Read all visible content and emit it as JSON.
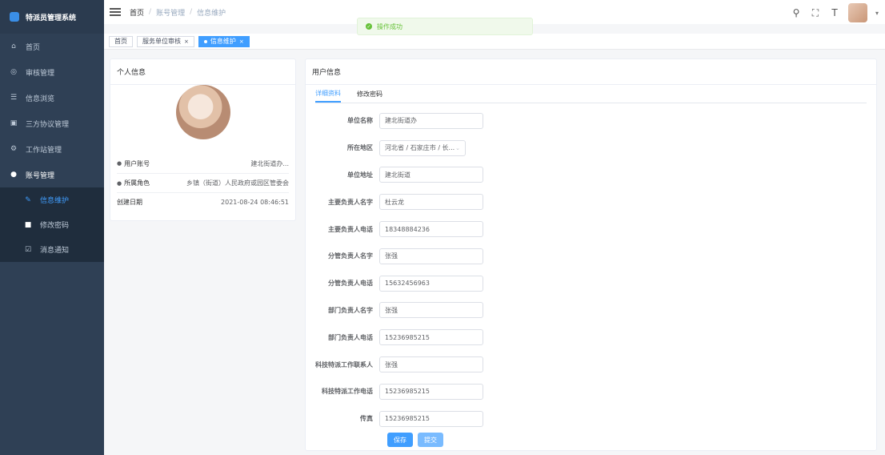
{
  "app": {
    "title": "特派员管理系统"
  },
  "sidebar": {
    "items": [
      {
        "label": "首页",
        "icon": "home-icon"
      },
      {
        "label": "审核管理",
        "icon": "audit-icon"
      },
      {
        "label": "信息浏览",
        "icon": "browse-icon"
      },
      {
        "label": "三方协议管理",
        "icon": "agreement-icon"
      },
      {
        "label": "工作站管理",
        "icon": "station-icon"
      },
      {
        "label": "账号管理",
        "icon": "user-icon"
      }
    ],
    "subitems": [
      {
        "label": "信息维护",
        "icon": "edit-icon",
        "active": true
      },
      {
        "label": "修改密码",
        "icon": "lock-icon"
      },
      {
        "label": "消息通知",
        "icon": "message-icon"
      }
    ]
  },
  "breadcrumb": [
    "首页",
    "账号管理",
    "信息维护"
  ],
  "tags": [
    {
      "label": "首页"
    },
    {
      "label": "服务单位审核"
    },
    {
      "label": "信息维护",
      "active": true
    }
  ],
  "toast": {
    "text": "操作成功"
  },
  "profile": {
    "title": "个人信息",
    "rows": [
      {
        "label": "用户账号",
        "value": "建北街道办..."
      },
      {
        "label": "所属角色",
        "value": "乡镇（街道）人民政府或园区管委会"
      },
      {
        "label": "创建日期",
        "value": "2021-08-24 08:46:51"
      }
    ]
  },
  "userinfo": {
    "title": "用户信息",
    "tabs": [
      "详细资料",
      "修改密码"
    ],
    "fields": [
      {
        "label": "单位名称",
        "value": "建北街道办"
      },
      {
        "label": "所在地区",
        "value": "河北省 / 石家庄市 / 长...",
        "select": true
      },
      {
        "label": "单位地址",
        "value": "建北街道"
      },
      {
        "label": "主要负责人名字",
        "value": "杜云龙"
      },
      {
        "label": "主要负责人电话",
        "value": "18348884236"
      },
      {
        "label": "分管负责人名字",
        "value": "张强"
      },
      {
        "label": "分管负责人电话",
        "value": "15632456963"
      },
      {
        "label": "部门负责人名字",
        "value": "张强"
      },
      {
        "label": "部门负责人电话",
        "value": "15236985215"
      },
      {
        "label": "科技特派工作联系人",
        "value": "张强"
      },
      {
        "label": "科技特派工作电话",
        "value": "15236985215"
      },
      {
        "label": "传真",
        "value": "15236985215"
      }
    ],
    "buttons": {
      "save": "保存",
      "submit": "提交"
    }
  },
  "colors": {
    "sidebar": "#2f4055",
    "accent": "#409eff",
    "success": "#67c23a"
  }
}
